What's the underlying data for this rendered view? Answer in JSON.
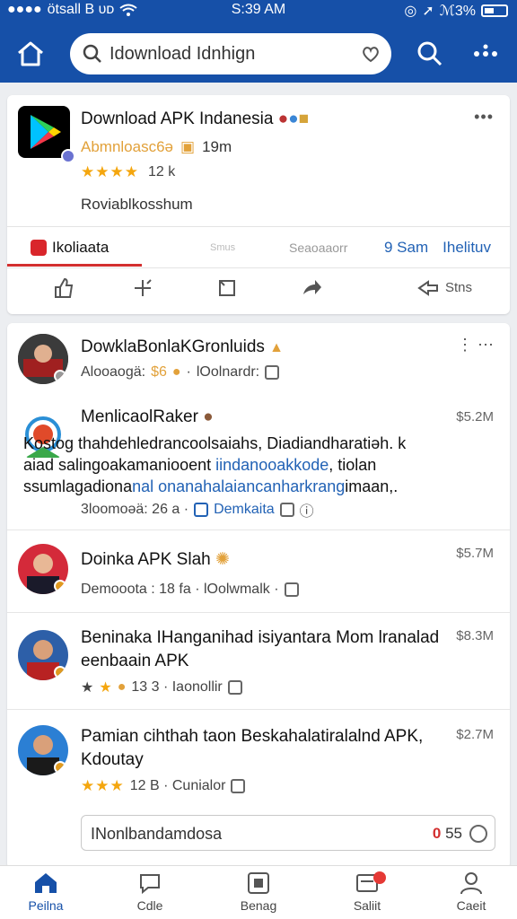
{
  "status_bar": {
    "carrier": "ötsall B ᴜᴅ",
    "time": "S:39 AM",
    "battery": "ℳ3%"
  },
  "header": {
    "search_text": "Idownload Idnhign"
  },
  "app_card": {
    "title": "Download APK Indanesia",
    "category": "Abmnloasc6ə",
    "downloads": "19m",
    "rating_stars": "★★★★",
    "rating_count": "12 k",
    "description": "Roviablkosshum",
    "tabs": {
      "active": "Ikoliaata",
      "faint1": "Smus",
      "faint2": "Seaoaaorr",
      "blue1": "9 Sam",
      "blue2": "Ihelituv"
    },
    "share_label": "Stns"
  },
  "list": [
    {
      "title": "DowklaBonlaKGronluids",
      "meta1": "Alooaogä:",
      "meta_orange": "$6",
      "meta2": "lOolnardr:",
      "dots": "⋮ ⋯"
    },
    {
      "title": "MenlicaolRaker",
      "price": "$5.2M",
      "body_line1": "Kostog thahdehledrancoolsaiahs, Diadiandharatiəh. k",
      "body_line2_plain": "aiad salingoakamaniooent ",
      "body_line2_blue": "iindanooakkode",
      "body_line2_end": ", tiolan",
      "body_line3_plain": "ssumlagadiona",
      "body_line3_blue": "nal onanahalaiancanharkrang",
      "body_line3_end": "imaan,.",
      "meta1": "3loomoəä: 26 a ·",
      "meta_blue": "Demkaita"
    },
    {
      "title": "Doinka APK Slah",
      "price": "$5.7M",
      "meta": "Demooota : 18 fa · lOolwmalk ·"
    },
    {
      "title": "Beninaka IHanganihad isiyantara Mom lranalad",
      "title2": "eenbaain APK",
      "price": "$8.3M",
      "meta": "13 3 · Iaonollir"
    },
    {
      "title": "Pamian cihthah taon Beskahalatiralalnd APK,",
      "title2": "Kdoutay",
      "price": "$2.7M",
      "stars": "★★★",
      "meta": "12 B · Cunialor"
    }
  ],
  "comment": {
    "placeholder": "INonlbandamdosa",
    "count_red": "0",
    "count": "55"
  },
  "bottom_nav": [
    {
      "label": "Peilna"
    },
    {
      "label": "Cdle"
    },
    {
      "label": "Benag"
    },
    {
      "label": "Saliit"
    },
    {
      "label": "Caeit"
    }
  ],
  "colors": {
    "brand": "#1650a8",
    "accent_red": "#d32f2f",
    "star": "#f4a60e",
    "link": "#2262b5"
  }
}
